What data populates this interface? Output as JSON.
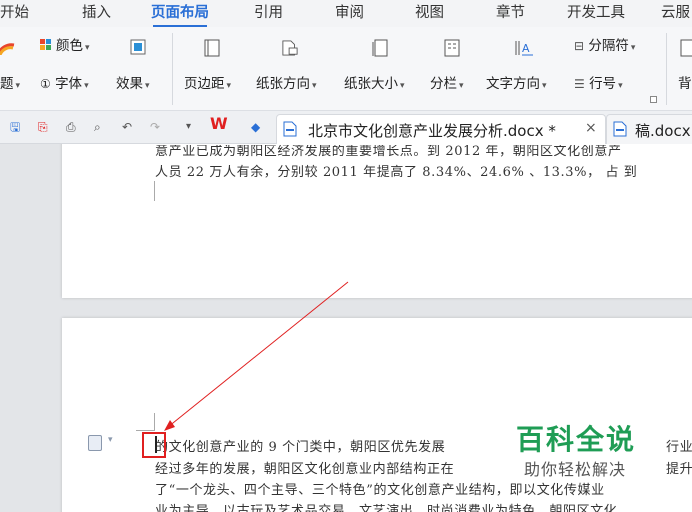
{
  "menu": {
    "tabs": [
      "开始",
      "插入",
      "页面布局",
      "引用",
      "审阅",
      "视图",
      "章节",
      "开发工具",
      "云服"
    ],
    "active_index": 2
  },
  "ribbon": {
    "colors": "颜色",
    "theme": "题",
    "font": "字体",
    "effects": "效果",
    "margins": "页边距",
    "orientation": "纸张方向",
    "size": "纸张大小",
    "columns": "分栏",
    "text_direction": "文字方向",
    "separator": "分隔符",
    "line_numbers": "行号",
    "background": "背"
  },
  "tabbar": {
    "active_doc_title": "北京市文化创意产业发展分析.docx *",
    "next_doc_title": "稿.docx"
  },
  "document": {
    "page1_line1": "意产业已成为朝阳区经济发展的重要增长点。到 2012 年，朝阳区文化创意产",
    "page1_line2": "人员 22 万人有余，分别较 2011 年提高了 8.34%、24.6% 、13.3%， 占 到",
    "page2_line1": "的文化创意产业的 9 个门类中，朝阳区优先发展",
    "page2_line1_tail": "行业",
    "page2_line2": "经过多年的发展，朝阳区文化创意业内部结构正在",
    "page2_line2_tail": "提升",
    "page2_line3": "了“一个龙头、四个主导、三个特色”的文化创意产业结构，即以文化传媒业",
    "page2_line4": "业为主导，以古玩及艺术品交易、文艺演出、时尚消费业为特色，朝阳区文化"
  },
  "watermark": {
    "title": "百科全说",
    "subtitle": "助你轻松解决"
  },
  "colors": {
    "accent": "#2a6fd6",
    "annotation": "#e02020",
    "watermark_green": "#1f9d55"
  }
}
